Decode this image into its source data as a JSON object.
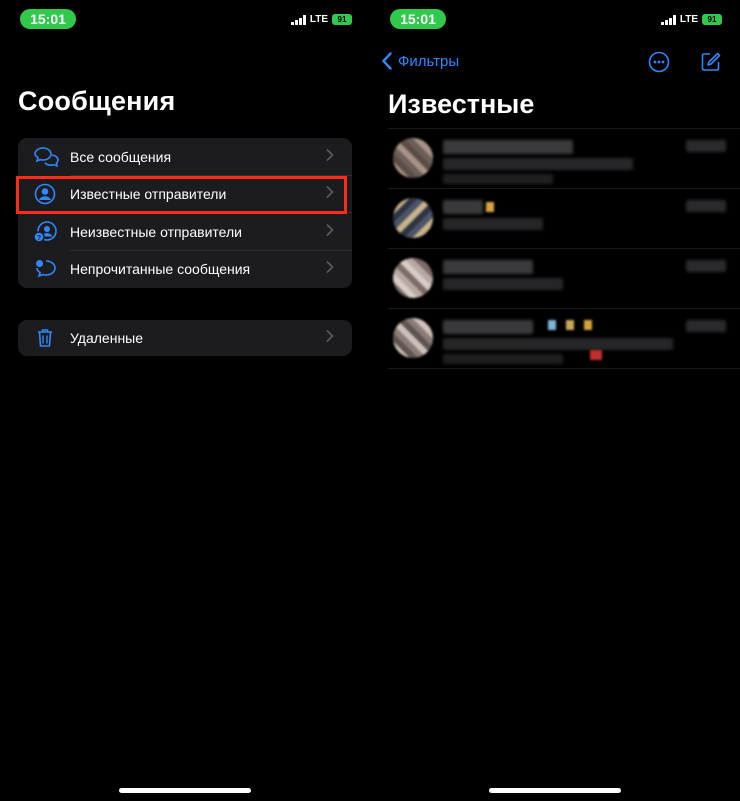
{
  "left_screen": {
    "status_bar": {
      "time": "15:01",
      "network": "LTE",
      "battery": "91"
    },
    "title": "Сообщения",
    "filters": [
      {
        "label": "Все сообщения",
        "icon": "chat-bubbles-icon"
      },
      {
        "label": "Известные отправители",
        "icon": "person-circle-icon",
        "highlighted": true
      },
      {
        "label": "Неизвестные отправители",
        "icon": "unknown-person-icon"
      },
      {
        "label": "Непрочитанные сообщения",
        "icon": "unread-bubble-icon"
      }
    ],
    "deleted": {
      "label": "Удаленные",
      "icon": "trash-icon"
    }
  },
  "right_screen": {
    "status_bar": {
      "time": "15:01",
      "network": "LTE",
      "battery": "91"
    },
    "back_label": "Фильтры",
    "title": "Известные"
  },
  "colors": {
    "accent": "#2f88ff",
    "highlight_border": "#ff2b1c",
    "time_pill": "#30c94b",
    "group_bg": "#1c1c1e"
  }
}
